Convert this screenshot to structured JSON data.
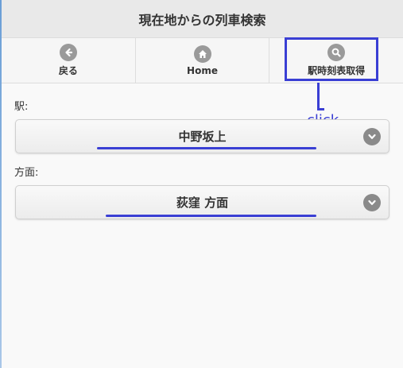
{
  "header": {
    "title": "現在地からの列車検索"
  },
  "nav": {
    "back_label": "戻る",
    "home_label": "Home",
    "timetable_label": "駅時刻表取得"
  },
  "annotation": {
    "note": "click."
  },
  "form": {
    "station_label": "駅:",
    "station_value": "中野坂上",
    "direction_label": "方面:",
    "direction_value": "荻窪 方面"
  },
  "colors": {
    "annotation": "#3a3fd4",
    "icon": "#9a9a9a",
    "header_bg": "#e9e9e9"
  },
  "icons": [
    "arrow-left-icon",
    "home-icon",
    "search-icon",
    "chevron-down-icon"
  ]
}
